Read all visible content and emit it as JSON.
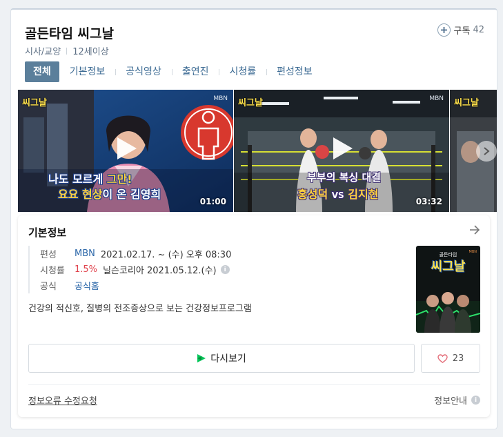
{
  "program": {
    "title": "골든타임 씨그날",
    "genre": "시사/교양",
    "rating": "12세이상"
  },
  "subscribe": {
    "label": "구독",
    "count": "42"
  },
  "tabs": [
    {
      "label": "전체",
      "active": true
    },
    {
      "label": "기본정보"
    },
    {
      "label": "공식영상"
    },
    {
      "label": "출연진"
    },
    {
      "label": "시청률"
    },
    {
      "label": "편성정보"
    }
  ],
  "videos": [
    {
      "duration": "01:00",
      "logo": "MBN",
      "caption_line1_a": "나도 모르게 ",
      "caption_line1_b": "그만!",
      "caption_line2_a": "요요 ",
      "caption_line2_b": "현상",
      "caption_line2_c": "이 온 김영희",
      "show_logo": "씨그날"
    },
    {
      "duration": "03:32",
      "logo": "MBN",
      "caption_top": "부부의 복싱 대결",
      "caption_name1": "홍성덕",
      "caption_vs": "VS",
      "caption_name2": "김지현",
      "show_logo": "씨그날"
    }
  ],
  "info": {
    "section_title": "기본정보",
    "broadcast_label": "편성",
    "broadcaster": "MBN",
    "broadcast_schedule": "2021.02.17. ~  (수) 오후 08:30",
    "ratings_label": "시청률",
    "ratings_value": "1.5%",
    "ratings_source": "닐슨코리아 2021.05.12.(수)",
    "official_label": "공식",
    "official_link": "공식홈",
    "description": "건강의 적신호, 질병의 전조증상으로 보는 건강정보프로그램",
    "poster_title": "씨그날",
    "poster_sub": "골든타임",
    "info_icon": "i"
  },
  "actions": {
    "replay_label": "다시보기",
    "like_count": "23"
  },
  "footer": {
    "report_label": "정보오류 수정요청",
    "guide_label": "정보안내"
  },
  "colors": {
    "tab_active": "#5b7f9b",
    "link": "#2a66a8",
    "rating_red": "#e0414b",
    "replay_green": "#03c75a"
  }
}
